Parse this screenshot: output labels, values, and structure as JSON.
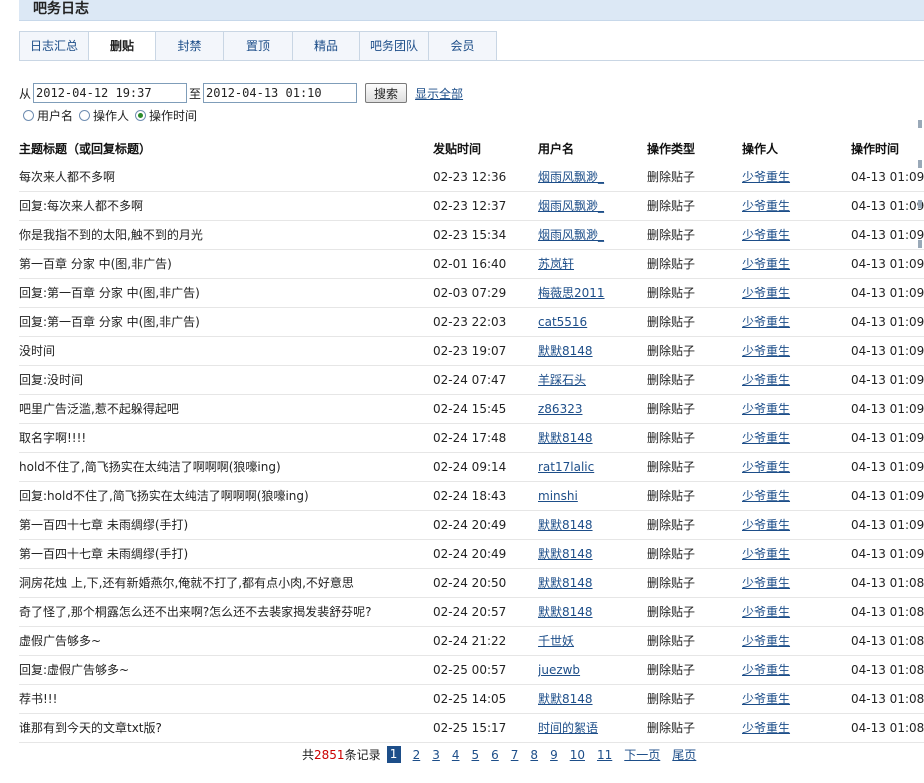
{
  "header": {
    "title": "吧务日志"
  },
  "tabs": [
    {
      "label": "日志汇总",
      "active": false
    },
    {
      "label": "删贴",
      "active": true
    },
    {
      "label": "封禁",
      "active": false
    },
    {
      "label": "置顶",
      "active": false
    },
    {
      "label": "精品",
      "active": false
    },
    {
      "label": "吧务团队",
      "active": false
    },
    {
      "label": "会员",
      "active": false
    }
  ],
  "filter": {
    "from_label": "从",
    "from_value": "2012-04-12 19:37",
    "to_label": "至",
    "to_value": "2012-04-13 01:10",
    "search_label": "搜索",
    "show_all_label": "显示全部",
    "radios": [
      {
        "label": "用户名",
        "checked": false
      },
      {
        "label": "操作人",
        "checked": false
      },
      {
        "label": "操作时间",
        "checked": true
      }
    ]
  },
  "table": {
    "columns": [
      "主题标题（或回复标题）",
      "发贴时间",
      "用户名",
      "操作类型",
      "操作人",
      "操作时间"
    ],
    "rows": [
      {
        "title": "每次来人都不多啊",
        "post_time": "02-23 12:36",
        "user": "烟雨风飘渺_",
        "type": "删除贴子",
        "operator": "少爷重生",
        "op_time": "04-13 01:09"
      },
      {
        "title": "回复:每次来人都不多啊",
        "post_time": "02-23 12:37",
        "user": "烟雨风飘渺_",
        "type": "删除贴子",
        "operator": "少爷重生",
        "op_time": "04-13 01:09"
      },
      {
        "title": "你是我指不到的太阳,触不到的月光",
        "post_time": "02-23 15:34",
        "user": "烟雨风飘渺_",
        "type": "删除贴子",
        "operator": "少爷重生",
        "op_time": "04-13 01:09"
      },
      {
        "title": "第一百章 分家 中(图,非广告)",
        "post_time": "02-01 16:40",
        "user": "苏岚轩",
        "type": "删除贴子",
        "operator": "少爷重生",
        "op_time": "04-13 01:09"
      },
      {
        "title": "回复:第一百章 分家 中(图,非广告)",
        "post_time": "02-03 07:29",
        "user": "梅薇思2011",
        "type": "删除贴子",
        "operator": "少爷重生",
        "op_time": "04-13 01:09"
      },
      {
        "title": "回复:第一百章 分家 中(图,非广告)",
        "post_time": "02-23 22:03",
        "user": "cat5516",
        "type": "删除贴子",
        "operator": "少爷重生",
        "op_time": "04-13 01:09"
      },
      {
        "title": "没时间",
        "post_time": "02-23 19:07",
        "user": "默默8148",
        "type": "删除贴子",
        "operator": "少爷重生",
        "op_time": "04-13 01:09"
      },
      {
        "title": "回复:没时间",
        "post_time": "02-24 07:47",
        "user": "羊踩石头",
        "type": "删除贴子",
        "operator": "少爷重生",
        "op_time": "04-13 01:09"
      },
      {
        "title": "吧里广告泛滥,惹不起躲得起吧",
        "post_time": "02-24 15:45",
        "user": "z86323",
        "type": "删除贴子",
        "operator": "少爷重生",
        "op_time": "04-13 01:09"
      },
      {
        "title": "取名字啊!!!!",
        "post_time": "02-24 17:48",
        "user": "默默8148",
        "type": "删除贴子",
        "operator": "少爷重生",
        "op_time": "04-13 01:09"
      },
      {
        "title": "hold不住了,简飞扬实在太纯洁了啊啊啊(狼嚎ing)",
        "post_time": "02-24 09:14",
        "user": "rat17lalic",
        "type": "删除贴子",
        "operator": "少爷重生",
        "op_time": "04-13 01:09"
      },
      {
        "title": "回复:hold不住了,简飞扬实在太纯洁了啊啊啊(狼嚎ing)",
        "post_time": "02-24 18:43",
        "user": "minshi",
        "type": "删除贴子",
        "operator": "少爷重生",
        "op_time": "04-13 01:09"
      },
      {
        "title": "第一百四十七章 未雨绸缪(手打)",
        "post_time": "02-24 20:49",
        "user": "默默8148",
        "type": "删除贴子",
        "operator": "少爷重生",
        "op_time": "04-13 01:09"
      },
      {
        "title": "第一百四十七章 未雨绸缪(手打)",
        "post_time": "02-24 20:49",
        "user": "默默8148",
        "type": "删除贴子",
        "operator": "少爷重生",
        "op_time": "04-13 01:09"
      },
      {
        "title": "洞房花烛 上,下,还有新婚燕尔,俺就不打了,都有点小肉,不好意思",
        "post_time": "02-24 20:50",
        "user": "默默8148",
        "type": "删除贴子",
        "operator": "少爷重生",
        "op_time": "04-13 01:08"
      },
      {
        "title": "奇了怪了,那个桐露怎么还不出来啊?怎么还不去裴家揭发裴舒芬呢?",
        "post_time": "02-24 20:57",
        "user": "默默8148",
        "type": "删除贴子",
        "operator": "少爷重生",
        "op_time": "04-13 01:08"
      },
      {
        "title": "虚假广告够多~",
        "post_time": "02-24 21:22",
        "user": "千世妖",
        "type": "删除贴子",
        "operator": "少爷重生",
        "op_time": "04-13 01:08"
      },
      {
        "title": "回复:虚假广告够多~",
        "post_time": "02-25 00:57",
        "user": "juezwb",
        "type": "删除贴子",
        "operator": "少爷重生",
        "op_time": "04-13 01:08"
      },
      {
        "title": "荐书!!!",
        "post_time": "02-25 14:05",
        "user": "默默8148",
        "type": "删除贴子",
        "operator": "少爷重生",
        "op_time": "04-13 01:08"
      },
      {
        "title": "谁那有到今天的文章txt版?",
        "post_time": "02-25 15:17",
        "user": "时间的絮语",
        "type": "删除贴子",
        "operator": "少爷重生",
        "op_time": "04-13 01:08"
      }
    ]
  },
  "pager": {
    "prefix": "共",
    "total": "2851",
    "suffix": "条记录",
    "current": "1",
    "pages": [
      "2",
      "3",
      "4",
      "5",
      "6",
      "7",
      "8",
      "9",
      "10",
      "11"
    ],
    "next_label": "下一页",
    "last_label": "尾页"
  }
}
